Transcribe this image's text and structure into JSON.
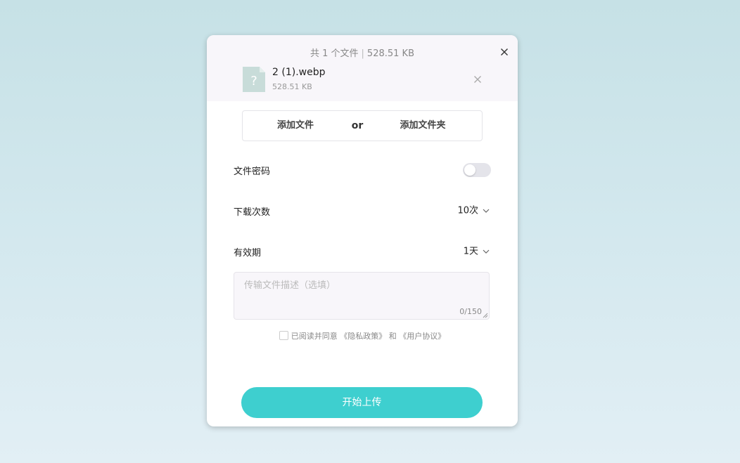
{
  "header": {
    "summary_count": "共 1 个文件",
    "summary_separator": "|",
    "summary_size": "528.51 KB",
    "close_icon": "close-icon"
  },
  "file": {
    "icon": "unknown-file-icon",
    "name": "2 (1).webp",
    "size": "528.51 KB",
    "remove_icon": "close-icon"
  },
  "add": {
    "file_label": "添加文件",
    "or_label": "or",
    "folder_label": "添加文件夹"
  },
  "settings": {
    "password_label": "文件密码",
    "password_enabled": false,
    "download_label": "下载次数",
    "download_value": "10次",
    "expiry_label": "有效期",
    "expiry_value": "1天"
  },
  "description": {
    "placeholder": "传输文件描述（选填）",
    "value": "",
    "counter": "0/150"
  },
  "agreement": {
    "prefix": "已阅读并同意",
    "privacy_link": "《隐私政策》",
    "and": "和",
    "terms_link": "《用户协议》",
    "checked": false
  },
  "upload_button": "开始上传",
  "colors": {
    "accent": "#3ecfcf",
    "panel": "#f8f6fa"
  }
}
